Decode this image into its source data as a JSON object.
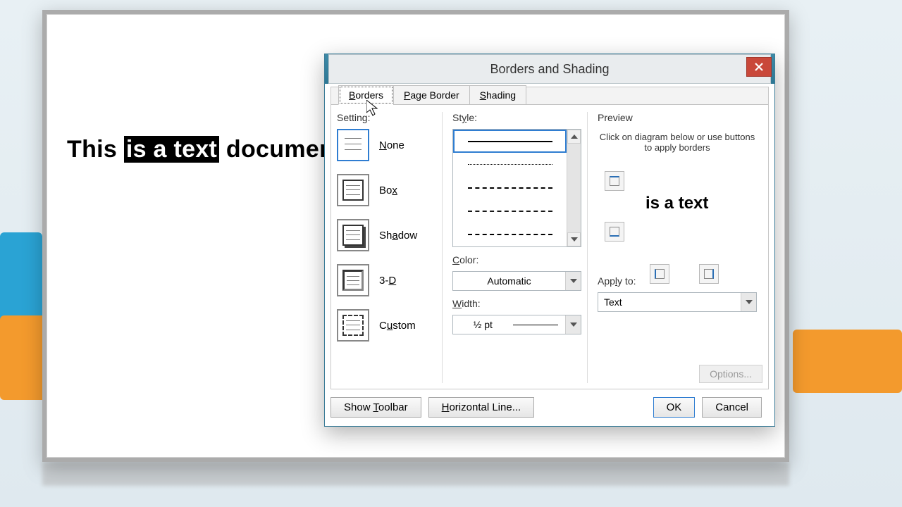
{
  "doc": {
    "before": "This ",
    "selected": "is a text",
    "after": " document."
  },
  "dialog": {
    "title": "Borders and Shading",
    "tabs": {
      "borders": "Borders",
      "page_border": "Page Border",
      "shading": "Shading"
    },
    "setting": {
      "label": "Setting:",
      "none": "None",
      "box": "Box",
      "shadow": "Shadow",
      "three_d": "3-D",
      "custom": "Custom"
    },
    "style": {
      "label": "Style:"
    },
    "color": {
      "label": "Color:",
      "value": "Automatic"
    },
    "width": {
      "label": "Width:",
      "value": "½ pt"
    },
    "preview": {
      "label": "Preview",
      "desc": "Click on diagram below or use buttons to apply borders",
      "sample": "is a text"
    },
    "apply": {
      "label": "Apply to:",
      "value": "Text"
    },
    "options": "Options...",
    "footer": {
      "show_toolbar": "Show Toolbar",
      "horizontal_line": "Horizontal Line...",
      "ok": "OK",
      "cancel": "Cancel"
    }
  }
}
